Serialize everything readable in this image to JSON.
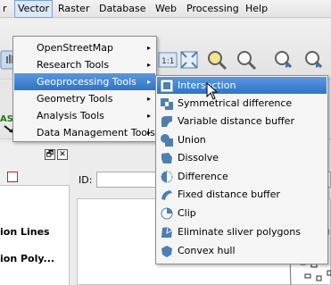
{
  "menubar": {
    "items": [
      {
        "label": "r"
      },
      {
        "label": "Vector"
      },
      {
        "label": "Raster"
      },
      {
        "label": "Database"
      },
      {
        "label": "Web"
      },
      {
        "label": "Processing"
      },
      {
        "label": "Help"
      }
    ]
  },
  "vector_menu": {
    "items": [
      {
        "label": "OpenStreetMap",
        "arrow": "▸"
      },
      {
        "label": "Research Tools",
        "arrow": "▸"
      },
      {
        "label": "Geoprocessing Tools",
        "arrow": "▸"
      },
      {
        "label": "Geometry Tools",
        "arrow": "▸"
      },
      {
        "label": "Analysis Tools",
        "arrow": "▸"
      },
      {
        "label": "Data Management Tools",
        "arrow": "▸"
      }
    ]
  },
  "geoprocessing_menu": {
    "items": [
      {
        "label": "Intersection",
        "icon": "intersection-icon"
      },
      {
        "label": "Symmetrical difference",
        "icon": "symmetrical-difference-icon"
      },
      {
        "label": "Variable distance buffer",
        "icon": "variable-buffer-icon"
      },
      {
        "label": "Union",
        "icon": "union-icon"
      },
      {
        "label": "Dissolve",
        "icon": "dissolve-icon"
      },
      {
        "label": "Difference",
        "icon": "difference-icon"
      },
      {
        "label": "Fixed distance buffer",
        "icon": "fixed-buffer-icon"
      },
      {
        "label": "Clip",
        "icon": "clip-icon"
      },
      {
        "label": "Eliminate sliver polygons",
        "icon": "eliminate-icon"
      },
      {
        "label": "Convex hull",
        "icon": "convex-hull-icon"
      }
    ]
  },
  "left_panel": {
    "float_button": "🗗",
    "close_button": "✕",
    "layers": [
      "ion Lines",
      "ion Poly..."
    ]
  },
  "attribute_bar": {
    "id_label": "ID:"
  },
  "toolbar": {
    "label_text": "abc",
    "as_text": "AS"
  },
  "colors": {
    "highlight": "#3a7fd0",
    "icon_blue": "#4d7fb0",
    "icon_yellow": "#e8c93a"
  }
}
